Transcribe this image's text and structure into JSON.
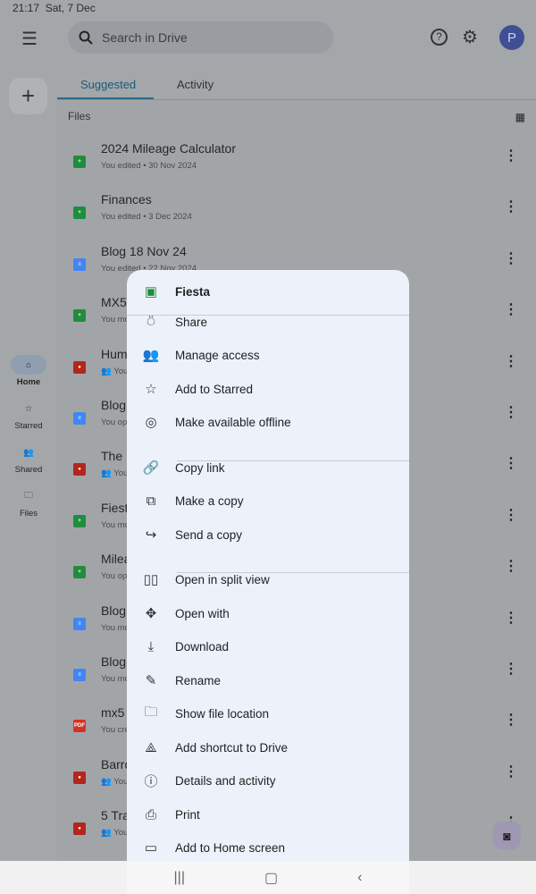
{
  "status": {
    "time": "21:17",
    "date": "Sat, 7 Dec"
  },
  "search": {
    "placeholder": "Search in Drive"
  },
  "avatar": "P",
  "tabs": [
    {
      "label": "Suggested",
      "active": true
    },
    {
      "label": "Activity"
    }
  ],
  "nav": [
    {
      "label": "Home",
      "icon": "home-icon",
      "active": true
    },
    {
      "label": "Starred",
      "icon": "star-icon"
    },
    {
      "label": "Shared",
      "icon": "people-icon"
    },
    {
      "label": "Files",
      "icon": "folder-icon"
    }
  ],
  "section": "Files",
  "files": [
    {
      "name": "2024 Mileage Calculator",
      "sub": "You edited • 30 Nov 2024",
      "type": "sheet"
    },
    {
      "name": "Finances",
      "sub": "You edited • 3 Dec 2024",
      "type": "sheet"
    },
    {
      "name": "Blog 18 Nov 24",
      "sub": "You edited • 22 Nov 2024",
      "type": "doc"
    },
    {
      "name": "MX5",
      "sub": "You mo",
      "type": "sheet"
    },
    {
      "name": "Huml",
      "sub": "You",
      "type": "map",
      "shared": true
    },
    {
      "name": "Blog",
      "sub": "You op",
      "type": "doc"
    },
    {
      "name": "The E",
      "sub": "You",
      "type": "map",
      "shared": true
    },
    {
      "name": "Fiest",
      "sub": "You mo",
      "type": "sheet"
    },
    {
      "name": "Milea",
      "sub": "You op",
      "type": "sheet"
    },
    {
      "name": "Blog",
      "sub": "You mo",
      "type": "doc"
    },
    {
      "name": "Blog",
      "sub": "You mo",
      "type": "doc"
    },
    {
      "name": "mx5",
      "sub": "You cre",
      "type": "pdf"
    },
    {
      "name": "Barro",
      "sub": "You",
      "type": "map",
      "shared": true
    },
    {
      "name": "5 Tra",
      "sub": "You",
      "type": "map",
      "shared": true
    }
  ],
  "colors": {
    "sheet": "#1e8e3e",
    "doc": "#4285f4",
    "map": "#b3261e",
    "pdf": "#d93025"
  },
  "menu": {
    "title": "Fiesta",
    "items": [
      {
        "label": "Share",
        "icon": "person-add-icon",
        "glyph": "⍥"
      },
      {
        "label": "Manage access",
        "icon": "people-icon",
        "glyph": "👥"
      },
      {
        "label": "Add to Starred",
        "icon": "star-icon",
        "glyph": "☆"
      },
      {
        "label": "Make available offline",
        "icon": "offline-icon",
        "glyph": "◎"
      },
      {
        "label": "Copy link",
        "icon": "link-icon",
        "glyph": "🔗"
      },
      {
        "label": "Make a copy",
        "icon": "copy-icon",
        "glyph": "⧉"
      },
      {
        "label": "Send a copy",
        "icon": "forward-icon",
        "glyph": "↪"
      },
      {
        "label": "Open in split view",
        "icon": "split-view-icon",
        "glyph": "▯▯"
      },
      {
        "label": "Open with",
        "icon": "open-with-icon",
        "glyph": "✥"
      },
      {
        "label": "Download",
        "icon": "download-icon",
        "glyph": "⤓"
      },
      {
        "label": "Rename",
        "icon": "pencil-icon",
        "glyph": "✎"
      },
      {
        "label": "Show file location",
        "icon": "folder-icon",
        "glyph": "🗀"
      },
      {
        "label": "Add shortcut to Drive",
        "icon": "shortcut-icon",
        "glyph": "⟁"
      },
      {
        "label": "Details and activity",
        "icon": "info-icon",
        "glyph": "ⓘ"
      },
      {
        "label": "Print",
        "icon": "print-icon",
        "glyph": "⎙"
      },
      {
        "label": "Add to Home screen",
        "icon": "home-screen-icon",
        "glyph": "▭"
      }
    ]
  }
}
